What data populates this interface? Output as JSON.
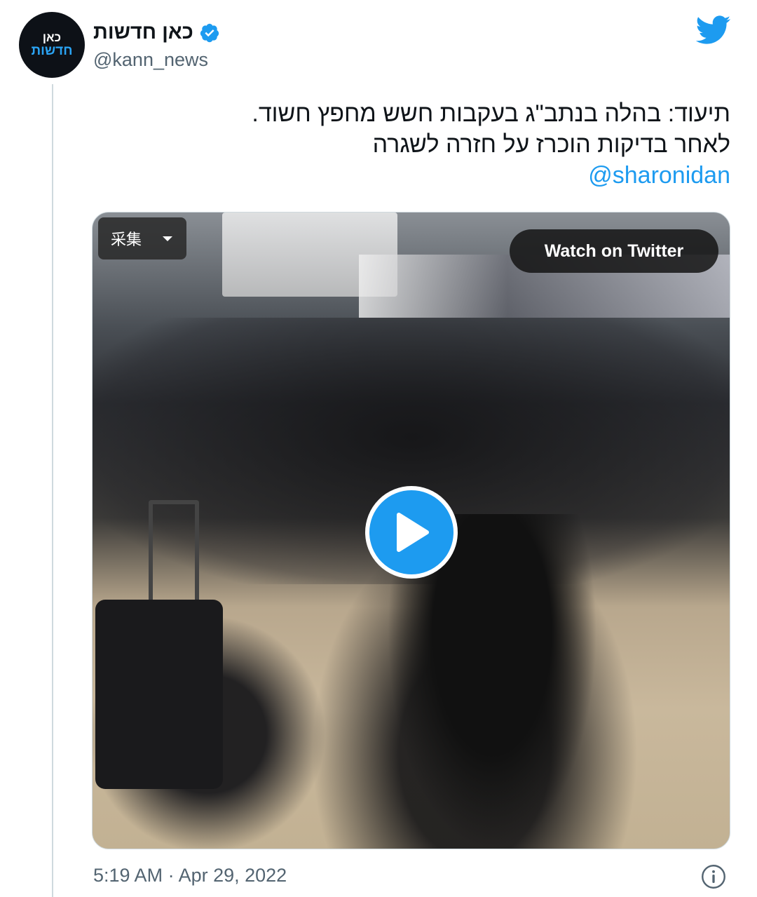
{
  "author": {
    "avatar_line1": "כאן",
    "avatar_line2": "חדשות",
    "display_name": "כאן חדשות",
    "handle": "@kann_news",
    "verified": true
  },
  "tweet": {
    "line1": "תיעוד: בהלה בנתב\"ג בעקבות חשש מחפץ חשוד.",
    "line2": "לאחר בדיקות הוכרז על חזרה לשגרה",
    "mention": "@sharonidan"
  },
  "media": {
    "quality_label": "采集",
    "watch_label": "Watch on Twitter"
  },
  "footer": {
    "timestamp": "5:19 AM · Apr 29, 2022"
  },
  "colors": {
    "brand_blue": "#1d9bf0",
    "text": "#0f1419",
    "muted": "#536471"
  },
  "icons": [
    "twitter-bird-icon",
    "verified-badge-icon",
    "play-icon",
    "info-icon",
    "chevron-down-icon"
  ]
}
